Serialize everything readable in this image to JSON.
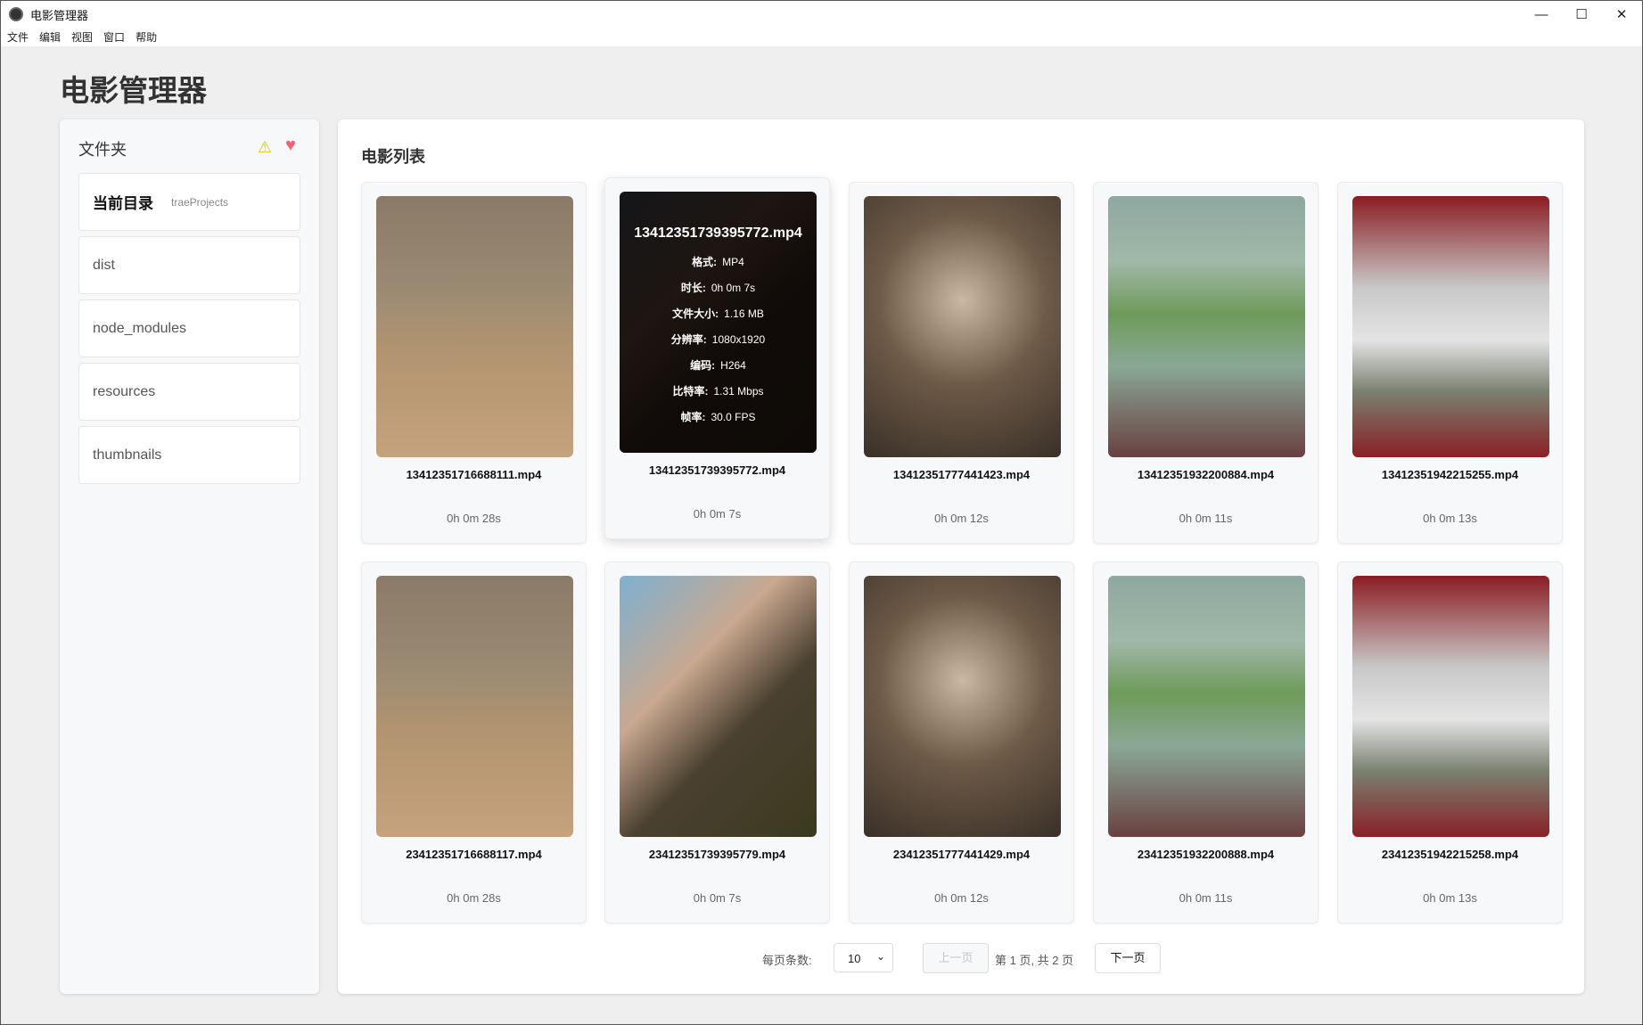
{
  "window": {
    "title": "电影管理器",
    "minimize": "—",
    "maximize": "☐",
    "close": "✕"
  },
  "menu": [
    "文件",
    "编辑",
    "视图",
    "窗口",
    "帮助"
  ],
  "heading": "电影管理器",
  "sidebar": {
    "title": "文件夹",
    "warning_icon": "⚠",
    "heart_icon": "♥",
    "current": {
      "label": "当前目录",
      "value": "traeProjects"
    },
    "folders": [
      "dist",
      "node_modules",
      "resources",
      "thumbnails"
    ]
  },
  "main": {
    "title": "电影列表",
    "movies": [
      {
        "name": "13412351716688111.mp4",
        "duration": "0h 0m 28s",
        "thumb": "t1"
      },
      {
        "name": "13412351739395772.mp4",
        "duration": "0h 0m 7s",
        "thumb": "t2"
      },
      {
        "name": "13412351777441423.mp4",
        "duration": "0h 0m 12s",
        "thumb": "t3"
      },
      {
        "name": "13412351932200884.mp4",
        "duration": "0h 0m 11s",
        "thumb": "t4"
      },
      {
        "name": "13412351942215255.mp4",
        "duration": "0h 0m 13s",
        "thumb": "t5"
      },
      {
        "name": "23412351716688117.mp4",
        "duration": "0h 0m 28s",
        "thumb": "t1"
      },
      {
        "name": "23412351739395779.mp4",
        "duration": "0h 0m 7s",
        "thumb": "t2"
      },
      {
        "name": "23412351777441429.mp4",
        "duration": "0h 0m 12s",
        "thumb": "t3"
      },
      {
        "name": "23412351932200888.mp4",
        "duration": "0h 0m 11s",
        "thumb": "t4"
      },
      {
        "name": "23412351942215258.mp4",
        "duration": "0h 0m 13s",
        "thumb": "t5"
      }
    ],
    "hover_info": {
      "title": "13412351739395772.mp4",
      "rows": [
        {
          "k": "格式:",
          "v": "MP4"
        },
        {
          "k": "时长:",
          "v": "0h 0m 7s"
        },
        {
          "k": "文件大小:",
          "v": "1.16 MB"
        },
        {
          "k": "分辨率:",
          "v": "1080x1920"
        },
        {
          "k": "编码:",
          "v": "H264"
        },
        {
          "k": "比特率:",
          "v": "1.31 Mbps"
        },
        {
          "k": "帧率:",
          "v": "30.0 FPS"
        }
      ]
    }
  },
  "pagination": {
    "page_size_label": "每页条数:",
    "page_size": "10",
    "prev": "上一页",
    "info": "第 1 页, 共 2 页",
    "next": "下一页"
  }
}
